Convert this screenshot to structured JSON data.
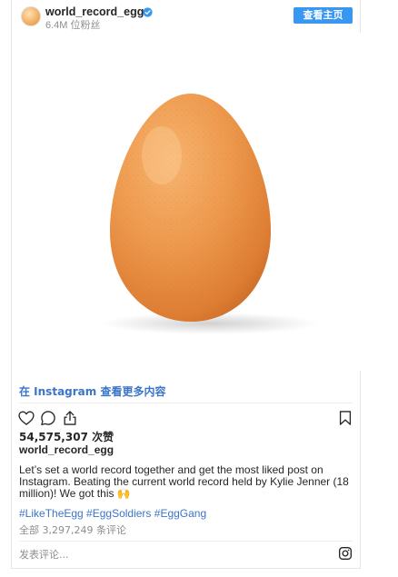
{
  "header": {
    "username": "world_record_egg",
    "followers": "6.4M 位粉丝",
    "view_profile_button": "查看主页"
  },
  "media": {
    "subject": "egg-photo"
  },
  "more_link": "在 Instagram 查看更多内容",
  "actions": {
    "like_icon": "heart-icon",
    "comment_icon": "comment-icon",
    "share_icon": "share-icon",
    "save_icon": "bookmark-icon"
  },
  "post": {
    "likes": "54,575,307 次赞",
    "owner": "world_record_egg",
    "caption": "Let’s set a world record together and get the most liked post on Instagram. Beating the current world record held by Kylie Jenner (18 million)! We got this 🙌",
    "hashtags": "#LikeTheEgg #EggSoldiers #EggGang",
    "comments": "全部 3,297,249 条评论"
  },
  "comment_box": {
    "placeholder": "发表评论..."
  },
  "colors": {
    "accent": "#3897f0",
    "link": "#3b74c9",
    "muted": "#8e8e8e"
  }
}
